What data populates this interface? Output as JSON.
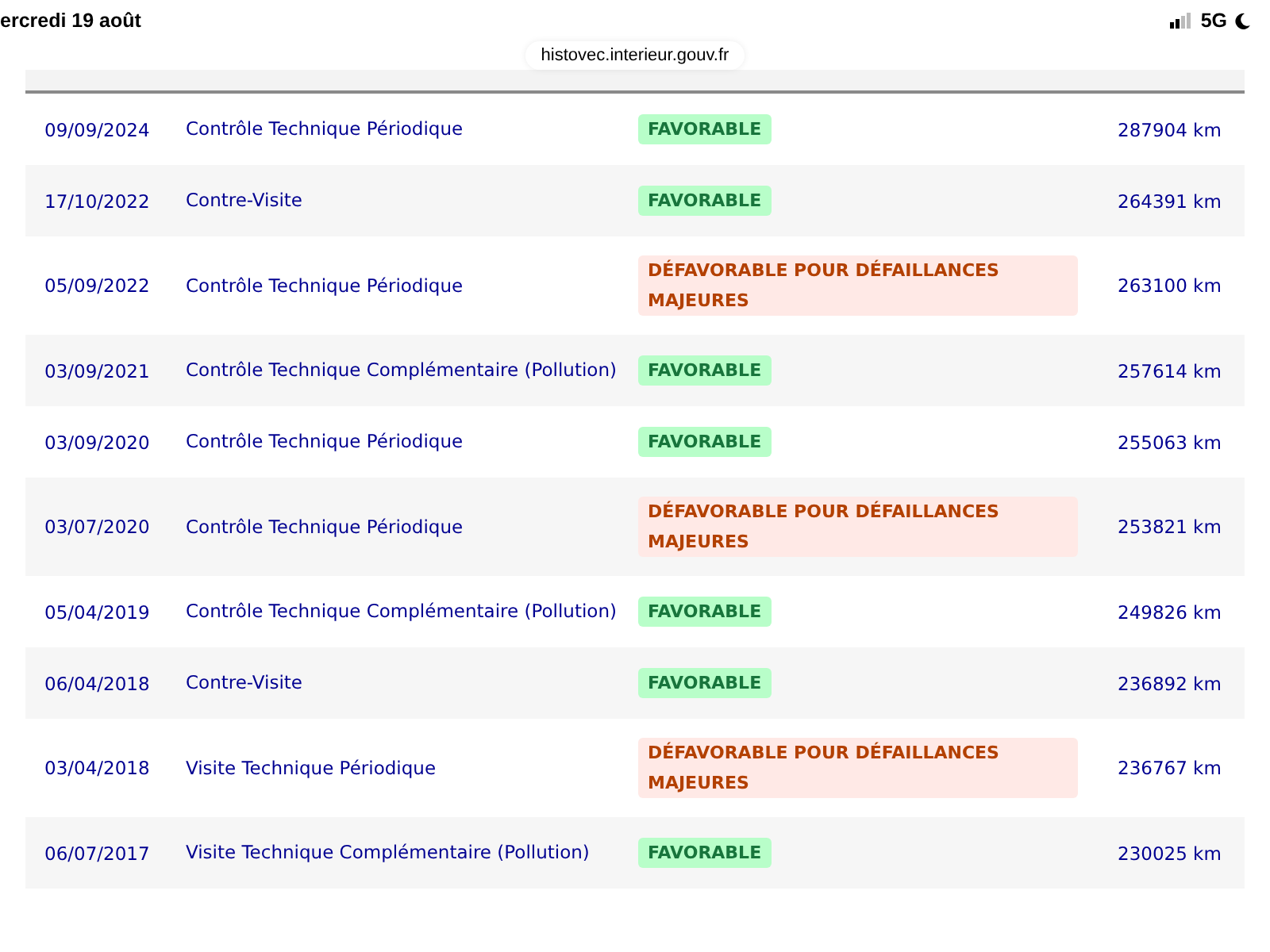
{
  "status_bar": {
    "date": "ercredi 19 août",
    "network": "5G"
  },
  "address_bar": {
    "url": "histovec.interieur.gouv.fr"
  },
  "table": {
    "rows": [
      {
        "date": "09/09/2024",
        "type": "Contrôle Technique Périodique",
        "result": {
          "kind": "favorable",
          "label": "FAVORABLE"
        },
        "mileage": "287904 km"
      },
      {
        "date": "17/10/2022",
        "type": "Contre-Visite",
        "result": {
          "kind": "favorable",
          "label": "FAVORABLE"
        },
        "mileage": "264391 km"
      },
      {
        "date": "05/09/2022",
        "type": "Contrôle Technique Périodique",
        "result": {
          "kind": "unfavorable",
          "label": "DÉFAVORABLE POUR DÉFAILLANCES MAJEURES"
        },
        "mileage": "263100 km"
      },
      {
        "date": "03/09/2021",
        "type": "Contrôle Technique Complémentaire (Pollution)",
        "result": {
          "kind": "favorable",
          "label": "FAVORABLE"
        },
        "mileage": "257614 km"
      },
      {
        "date": "03/09/2020",
        "type": "Contrôle Technique Périodique",
        "result": {
          "kind": "favorable",
          "label": "FAVORABLE"
        },
        "mileage": "255063 km"
      },
      {
        "date": "03/07/2020",
        "type": "Contrôle Technique Périodique",
        "result": {
          "kind": "unfavorable",
          "label": "DÉFAVORABLE POUR DÉFAILLANCES MAJEURES"
        },
        "mileage": "253821 km"
      },
      {
        "date": "05/04/2019",
        "type": "Contrôle Technique Complémentaire (Pollution)",
        "result": {
          "kind": "favorable",
          "label": "FAVORABLE"
        },
        "mileage": "249826 km"
      },
      {
        "date": "06/04/2018",
        "type": "Contre-Visite",
        "result": {
          "kind": "favorable",
          "label": "FAVORABLE"
        },
        "mileage": "236892 km"
      },
      {
        "date": "03/04/2018",
        "type": "Visite Technique Périodique",
        "result": {
          "kind": "unfavorable",
          "label": "DÉFAVORABLE POUR DÉFAILLANCES MAJEURES"
        },
        "mileage": "236767 km"
      },
      {
        "date": "06/07/2017",
        "type": "Visite Technique Complémentaire (Pollution)",
        "result": {
          "kind": "favorable",
          "label": "FAVORABLE"
        },
        "mileage": "230025 km"
      }
    ]
  }
}
